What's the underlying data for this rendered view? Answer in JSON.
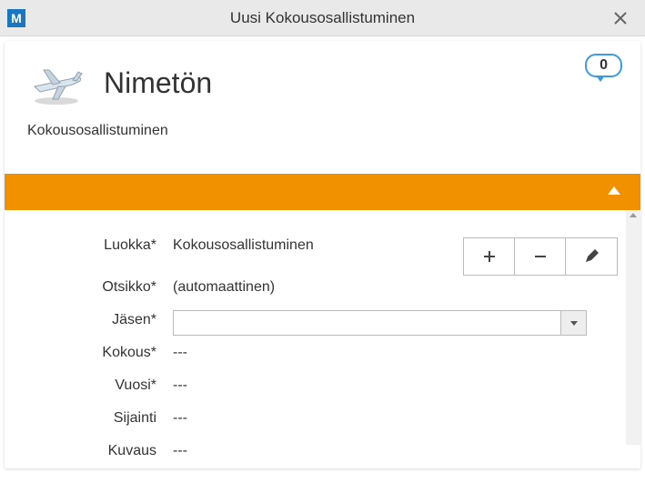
{
  "window": {
    "title": "Uusi Kokousosallistuminen"
  },
  "header": {
    "page_title": "Nimetön",
    "subtitle": "Kokousosallistuminen",
    "comment_count": "0"
  },
  "form": {
    "fields": [
      {
        "label": "Luokka*",
        "value": "Kokousosallistuminen"
      },
      {
        "label": "Otsikko*",
        "value": "(automaattinen)"
      },
      {
        "label": "Jäsen*",
        "value": ""
      },
      {
        "label": "Kokous*",
        "value": "---"
      },
      {
        "label": "Vuosi*",
        "value": "---"
      },
      {
        "label": "Sijainti",
        "value": "---"
      },
      {
        "label": "Kuvaus",
        "value": "---"
      }
    ]
  }
}
